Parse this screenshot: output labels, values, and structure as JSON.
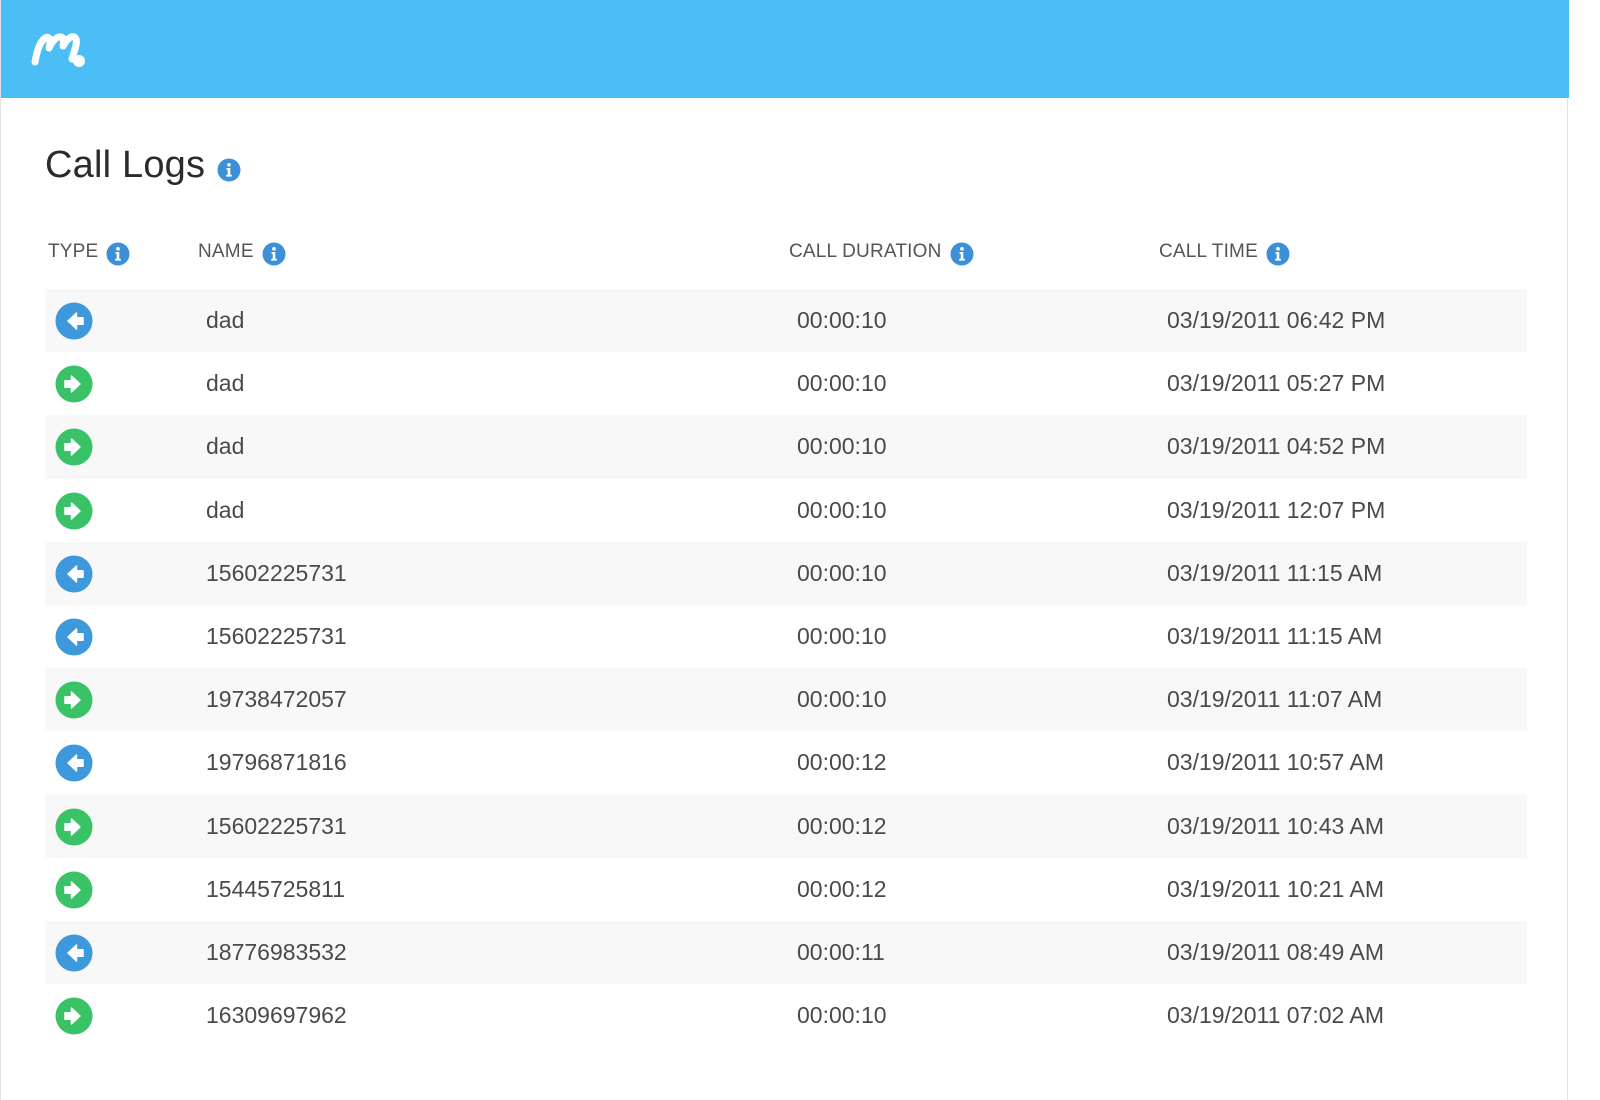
{
  "header": {
    "logo_icon": "mspy-logo-icon",
    "color": "#4bbff5"
  },
  "page": {
    "title": "Call Logs",
    "title_info_icon": "info-icon"
  },
  "table": {
    "columns": {
      "type": "TYPE",
      "name": "NAME",
      "duration": "CALL DURATION",
      "time": "CALL TIME"
    },
    "type_colors": {
      "incoming": "#3d98dc",
      "outgoing": "#3ac267"
    },
    "rows": [
      {
        "type": "incoming",
        "icon": "incoming-call-arrow-icon",
        "name": "dad",
        "duration": "00:00:10",
        "time": "03/19/2011 06:42 PM"
      },
      {
        "type": "outgoing",
        "icon": "outgoing-call-arrow-icon",
        "name": "dad",
        "duration": "00:00:10",
        "time": "03/19/2011 05:27 PM"
      },
      {
        "type": "outgoing",
        "icon": "outgoing-call-arrow-icon",
        "name": "dad",
        "duration": "00:00:10",
        "time": "03/19/2011 04:52 PM"
      },
      {
        "type": "outgoing",
        "icon": "outgoing-call-arrow-icon",
        "name": "dad",
        "duration": "00:00:10",
        "time": "03/19/2011 12:07 PM"
      },
      {
        "type": "incoming",
        "icon": "incoming-call-arrow-icon",
        "name": "15602225731",
        "duration": "00:00:10",
        "time": "03/19/2011 11:15 AM"
      },
      {
        "type": "incoming",
        "icon": "incoming-call-arrow-icon",
        "name": "15602225731",
        "duration": "00:00:10",
        "time": "03/19/2011 11:15 AM"
      },
      {
        "type": "outgoing",
        "icon": "outgoing-call-arrow-icon",
        "name": "19738472057",
        "duration": "00:00:10",
        "time": "03/19/2011 11:07 AM"
      },
      {
        "type": "incoming",
        "icon": "incoming-call-arrow-icon",
        "name": "19796871816",
        "duration": "00:00:12",
        "time": "03/19/2011 10:57 AM"
      },
      {
        "type": "outgoing",
        "icon": "outgoing-call-arrow-icon",
        "name": "15602225731",
        "duration": "00:00:12",
        "time": "03/19/2011 10:43 AM"
      },
      {
        "type": "outgoing",
        "icon": "outgoing-call-arrow-icon",
        "name": "15445725811",
        "duration": "00:00:12",
        "time": "03/19/2011 10:21 AM"
      },
      {
        "type": "incoming",
        "icon": "incoming-call-arrow-icon",
        "name": "18776983532",
        "duration": "00:00:11",
        "time": "03/19/2011 08:49 AM"
      },
      {
        "type": "outgoing",
        "icon": "outgoing-call-arrow-icon",
        "name": "16309697962",
        "duration": "00:00:10",
        "time": "03/19/2011 07:02 AM"
      }
    ]
  }
}
